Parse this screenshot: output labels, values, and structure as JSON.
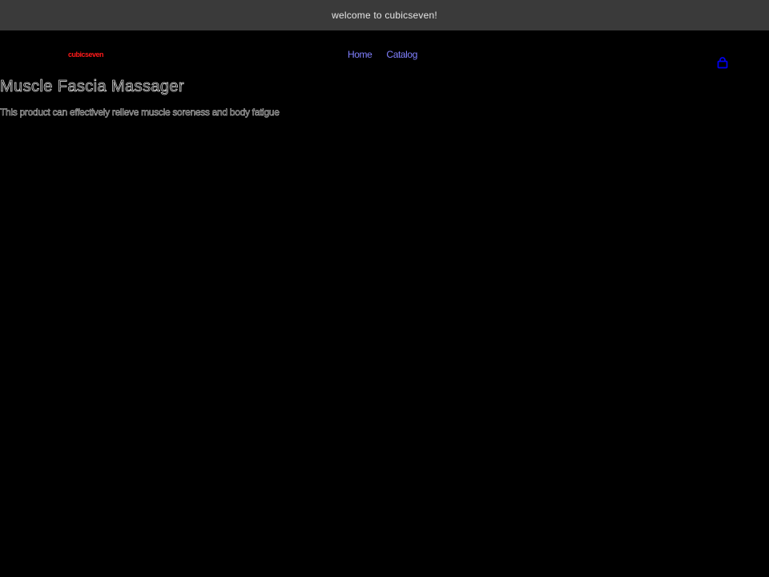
{
  "announcement": {
    "text": "welcome to cubicseven!"
  },
  "header": {
    "logo_text": "cubicseven",
    "nav": [
      {
        "label": "Home"
      },
      {
        "label": "Catalog"
      }
    ],
    "cart_icon": "bag-icon"
  },
  "product": {
    "title": "Muscle Fascia Massager",
    "description": "This product can effectively relieve muscle soreness and body fatigue"
  },
  "colors": {
    "background": "#000000",
    "announcement_bg": "#3a3a3a",
    "logo": "#ff1a1a",
    "nav_link": "#8080ff",
    "cart_icon": "#0000ee"
  }
}
